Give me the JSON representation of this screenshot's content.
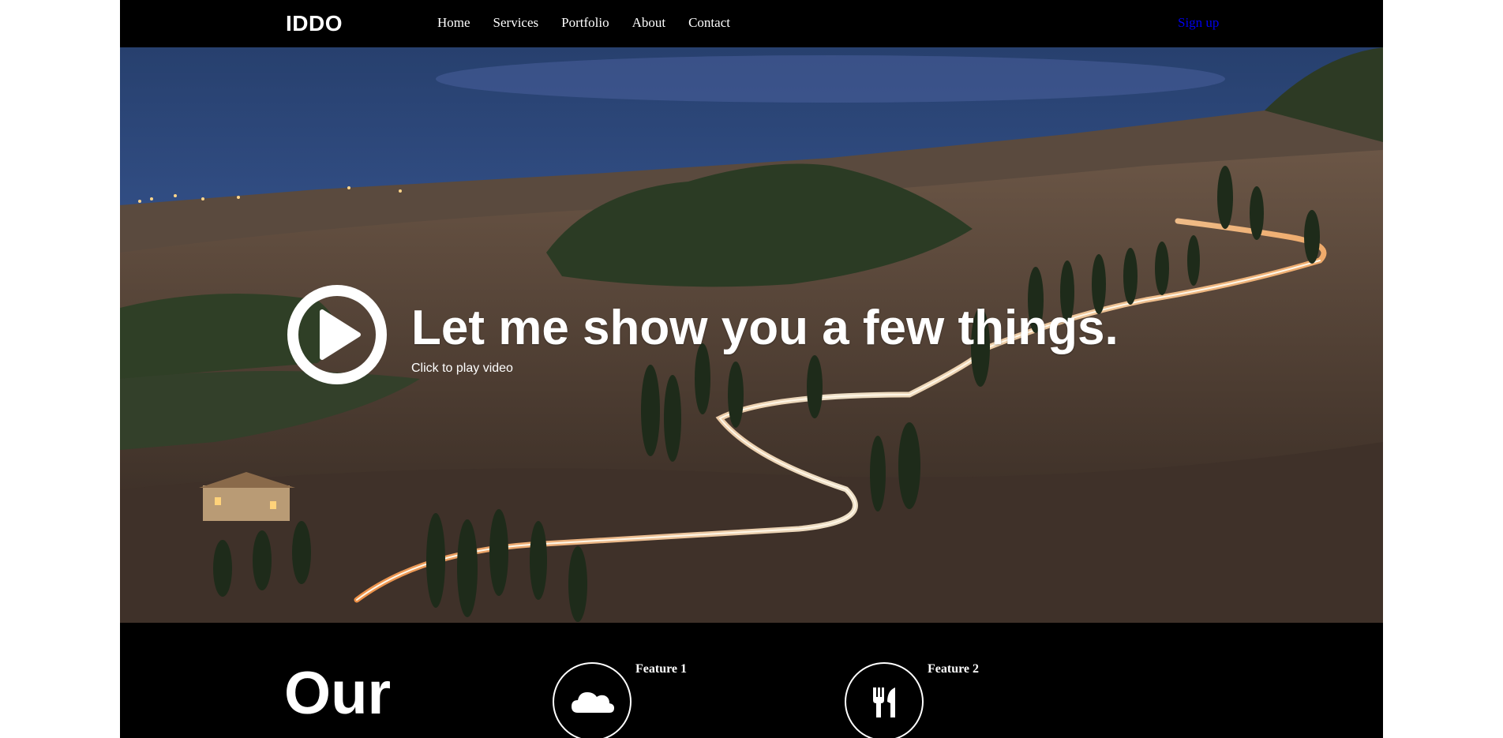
{
  "header": {
    "logo": "IDDO",
    "nav": [
      {
        "label": "Home"
      },
      {
        "label": "Services"
      },
      {
        "label": "Portfolio"
      },
      {
        "label": "About"
      },
      {
        "label": "Contact"
      }
    ],
    "signup": "Sign up"
  },
  "hero": {
    "title": "Let me show you a few things.",
    "subtitle": "Click to play video",
    "play_icon": "play-circle-icon"
  },
  "features": {
    "heading": "Our",
    "items": [
      {
        "title": "Feature 1",
        "icon": "cloud-icon"
      },
      {
        "title": "Feature 2",
        "icon": "utensils-icon"
      }
    ]
  },
  "colors": {
    "background": "#000000",
    "link": "#0000ee",
    "text": "#ffffff"
  }
}
